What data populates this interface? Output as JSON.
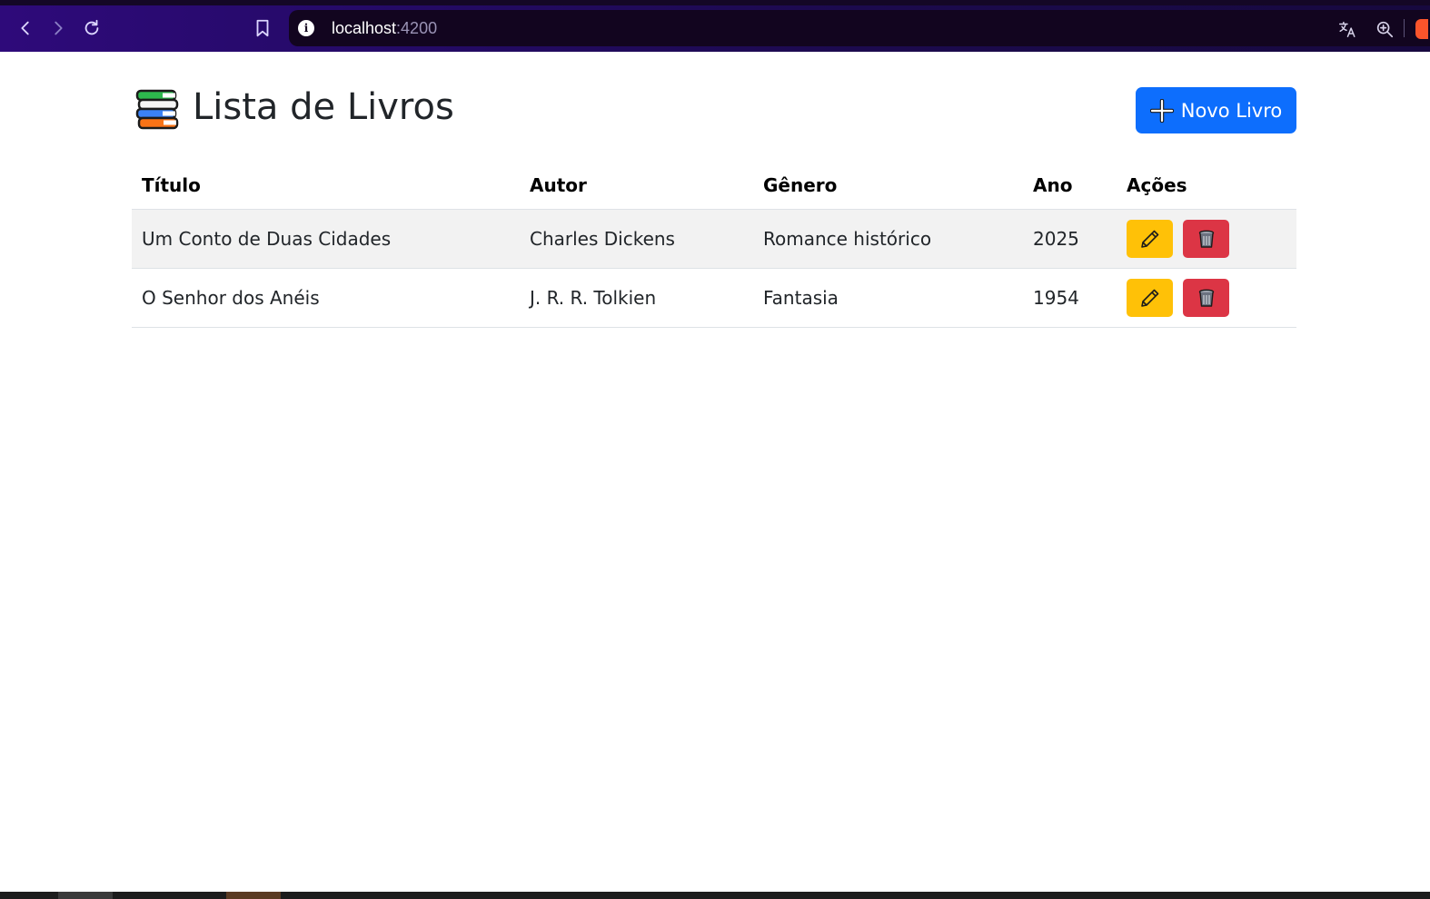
{
  "browser": {
    "url_host": "localhost",
    "url_port": ":4200",
    "icons": [
      "back-icon",
      "forward-icon",
      "reload-icon",
      "bookmark-icon",
      "site-info-icon",
      "translate-icon",
      "zoom-icon",
      "brave-shield-icon"
    ]
  },
  "header": {
    "title": "Lista de Livros",
    "icon": "books-icon",
    "new_button_label": "Novo Livro"
  },
  "table": {
    "columns": [
      "Título",
      "Autor",
      "Gênero",
      "Ano",
      "Ações"
    ],
    "rows": [
      {
        "title": "Um Conto de Duas Cidades",
        "author": "Charles Dickens",
        "genre": "Romance histórico",
        "year": "2025"
      },
      {
        "title": "O Senhor dos Anéis",
        "author": "J. R. R. Tolkien",
        "genre": "Fantasia",
        "year": "1954"
      }
    ]
  },
  "colors": {
    "primary": "#0d6efd",
    "warning": "#ffc107",
    "danger": "#dc3545",
    "toolbar": "#2e0a7a"
  }
}
